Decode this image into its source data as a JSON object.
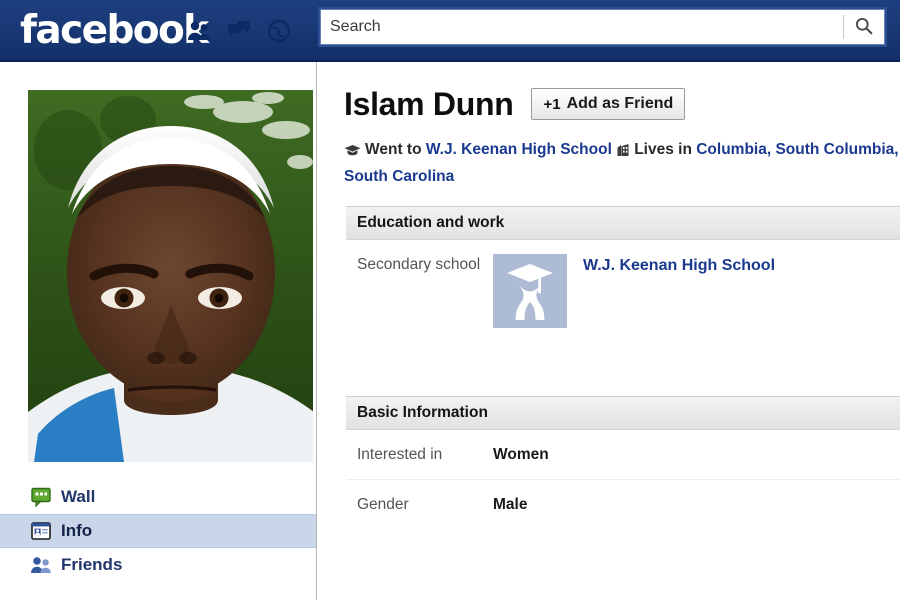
{
  "brand": {
    "logo_text": "facebook",
    "header_bar_color": "#183a7c",
    "link_color": "#1b3a8f"
  },
  "header": {
    "icons": [
      {
        "name": "friend-requests-icon",
        "label": "Friend Requests"
      },
      {
        "name": "messages-icon",
        "label": "Messages"
      },
      {
        "name": "notifications-icon",
        "label": "Notifications"
      }
    ],
    "search": {
      "placeholder": "Search",
      "value": "",
      "button_icon": "search-icon"
    }
  },
  "sidebar": {
    "photo_alt": "Profile photo of Islam Dunn",
    "items": [
      {
        "label": "Wall",
        "icon": "wall-icon",
        "selected": false
      },
      {
        "label": "Info",
        "icon": "info-card-icon",
        "selected": true
      },
      {
        "label": "Friends",
        "icon": "friends-icon",
        "selected": false
      }
    ]
  },
  "profile": {
    "name": "Islam Dunn",
    "add_friend": {
      "plus": "+1",
      "label": "Add as Friend"
    },
    "meta": {
      "education_prefix": "Went to",
      "education_link": "W.J. Keenan High School",
      "location_prefix": "Lives in",
      "location_link": "Columbia, South Columbia, South Carolina"
    }
  },
  "sections": [
    {
      "title": "Education and work",
      "rows": [
        {
          "label": "Secondary school",
          "thumb": "graduate-icon",
          "value": "W.J. Keenan High School"
        }
      ]
    },
    {
      "title": "Basic Information",
      "rows": [
        {
          "label": "Interested in",
          "value": "Women"
        },
        {
          "label": "Gender",
          "value": "Male"
        }
      ]
    }
  ]
}
